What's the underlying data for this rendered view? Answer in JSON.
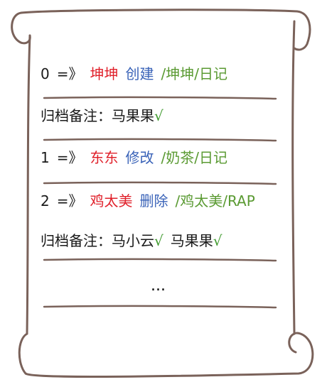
{
  "log": [
    {
      "index": "0",
      "arrow": "=》",
      "name": "坤坤",
      "action": "创建",
      "path": "/坤坤/日记"
    },
    {
      "index": "1",
      "arrow": "=》",
      "name": "东东",
      "action": "修改",
      "path": "/奶茶/日记"
    },
    {
      "index": "2",
      "arrow": "=》",
      "name": "鸡太美",
      "action": "删除",
      "path": "/鸡太美/RAP"
    }
  ],
  "notes": [
    {
      "label": "归档备注：",
      "entries": [
        {
          "name": "马果果",
          "check": "√"
        }
      ]
    },
    {
      "label": "归档备注：",
      "entries": [
        {
          "name": "马小云",
          "check": "√"
        },
        {
          "name": "马果果",
          "check": "√"
        }
      ]
    }
  ],
  "ellipsis": "...",
  "colors": {
    "name": "#e0202a",
    "action": "#3a63b8",
    "path": "#5a9a32",
    "check": "#3f9a2e",
    "stroke": "#7a625a"
  }
}
